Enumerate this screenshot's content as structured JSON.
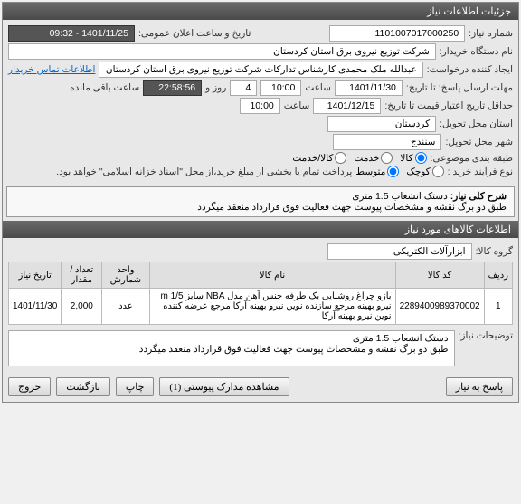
{
  "header": {
    "title": "جزئیات اطلاعات نیاز"
  },
  "fields": {
    "need_no_label": "شماره نیاز:",
    "need_no": "1101007017000250",
    "announce_label": "تاریخ و ساعت اعلان عمومی:",
    "announce_value": "1401/11/25 - 09:32",
    "buyer_label": "نام دستگاه خریدار:",
    "buyer_value": "شرکت توزیع نیروی برق استان کردستان",
    "creator_label": "ایجاد کننده درخواست:",
    "creator_value": "عبدالله ملک محمدی کارشناس تدارکات شرکت توزیع نیروی برق استان کردستان",
    "contact_link": "اطلاعات تماس خریدار",
    "deadline_label": "مهلت ارسال پاسخ: تا تاریخ:",
    "deadline_date": "1401/11/30",
    "time_label": "ساعت",
    "deadline_time": "10:00",
    "days_count": "4",
    "days_label": "روز و",
    "countdown": "22:58:56",
    "remain_label": "ساعت باقی مانده",
    "valid_label": "حداقل تاریخ اعتبار قیمت تا تاریخ:",
    "valid_date": "1401/12/15",
    "valid_time": "10:00",
    "province_label": "استان محل تحویل:",
    "province_value": "کردستان",
    "city_label": "شهر محل تحویل:",
    "city_value": "سنندج",
    "category_label": "طبقه بندی موضوعی:",
    "cat_kala": "کالا",
    "cat_khadamat": "خدمت",
    "cat_both": "کالا/خدمت",
    "process_label": "نوع فرآیند خرید :",
    "proc_small": "کوچک",
    "proc_mid": "متوسط",
    "proc_note": "پرداخت تمام یا بخشی از مبلغ خرید،از محل \"اسناد خزانه اسلامی\" خواهد بود."
  },
  "summary": {
    "title": "شرح کلی نیاز:",
    "line1": "دستک انشعاب 1.5 متری",
    "line2": "طبق دو برگ نقشه و مشخصات پیوست جهت فعالیت فوق قرارداد منعقد میگردد"
  },
  "goods_section": "اطلاعات کالاهای مورد نیاز",
  "group_label": "گروه کالا:",
  "group_value": "ابزارآلات الکتریکی",
  "table": {
    "h_row": "ردیف",
    "h_code": "کد کالا",
    "h_name": "نام کالا",
    "h_unit": "واحد شمارش",
    "h_qty": "تعداد / مقدار",
    "h_date": "تاریخ نیاز",
    "r1_row": "1",
    "r1_code": "2289400989370002",
    "r1_name": "بازو چراغ روشنایی یک طرفه جنس آهن مدل NBA سایز m 1/5 نیرو بهینه مرجع سازنده نوین نیرو بهینه آرکا مرجع عرضه کننده نوین نیرو بهینه آرکا",
    "r1_unit": "عدد",
    "r1_qty": "2,000",
    "r1_date": "1401/11/30"
  },
  "notes": {
    "label": "توضیحات نیاز:",
    "line1": "دستک انشعاب 1.5 متری",
    "line2": "طبق دو برگ نقشه و مشخصات پیوست جهت فعالیت فوق قرارداد منعقد میگردد"
  },
  "buttons": {
    "reply": "پاسخ به نیاز",
    "attachments": "مشاهده مدارک پیوستی (1)",
    "print": "چاپ",
    "back": "بازگشت",
    "exit": "خروج"
  }
}
